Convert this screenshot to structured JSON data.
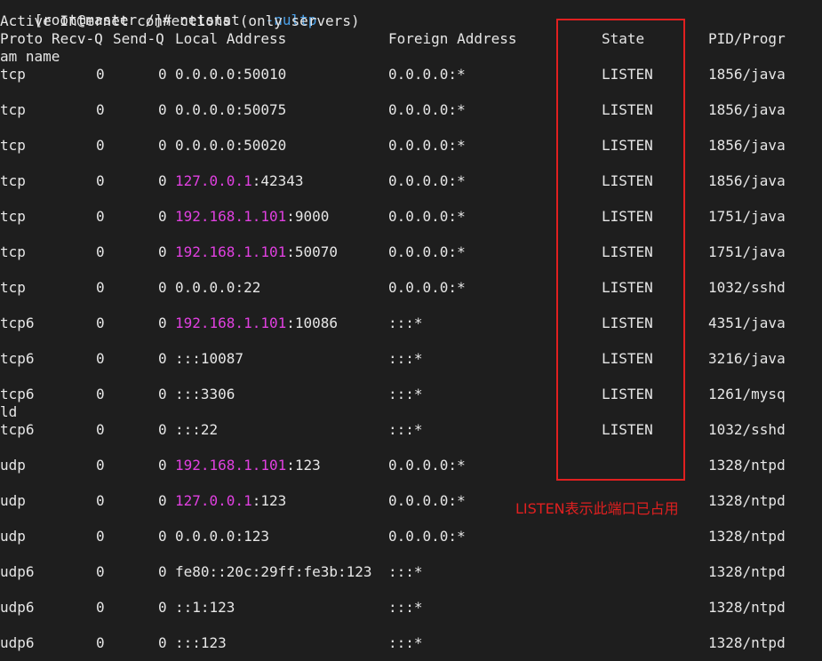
{
  "colors": {
    "background": "#1e1e1e",
    "text": "#e6e6e6",
    "ip_highlight": "#e040e0",
    "command_flag": "#4aa0e8",
    "annotation_red": "#e02020"
  },
  "prompt": {
    "prefix": "[root@master /]# netstat   ",
    "flag": "-nultp"
  },
  "title_line": "Active Internet connections (only servers)",
  "headers": {
    "proto": "Proto",
    "recvq": "Recv-Q",
    "sendq": "Send-Q",
    "local": "Local Address",
    "foreign": "Foreign Address",
    "state": "State",
    "pid": "PID/Progr",
    "pid_wrap": "am name"
  },
  "rows": [
    {
      "proto": "tcp",
      "recvq": "0",
      "sendq": "0",
      "local_ip": "0.0.0.0",
      "local_ip_highlight": false,
      "local_port": ":50010",
      "foreign": "0.0.0.0:*",
      "state": "LISTEN",
      "pid": "1856/java",
      "wrap": ""
    },
    {
      "proto": "tcp",
      "recvq": "0",
      "sendq": "0",
      "local_ip": "0.0.0.0",
      "local_ip_highlight": false,
      "local_port": ":50075",
      "foreign": "0.0.0.0:*",
      "state": "LISTEN",
      "pid": "1856/java",
      "wrap": ""
    },
    {
      "proto": "tcp",
      "recvq": "0",
      "sendq": "0",
      "local_ip": "0.0.0.0",
      "local_ip_highlight": false,
      "local_port": ":50020",
      "foreign": "0.0.0.0:*",
      "state": "LISTEN",
      "pid": "1856/java",
      "wrap": ""
    },
    {
      "proto": "tcp",
      "recvq": "0",
      "sendq": "0",
      "local_ip": "127.0.0.1",
      "local_ip_highlight": true,
      "local_port": ":42343",
      "foreign": "0.0.0.0:*",
      "state": "LISTEN",
      "pid": "1856/java",
      "wrap": ""
    },
    {
      "proto": "tcp",
      "recvq": "0",
      "sendq": "0",
      "local_ip": "192.168.1.101",
      "local_ip_highlight": true,
      "local_port": ":9000",
      "foreign": "0.0.0.0:*",
      "state": "LISTEN",
      "pid": "1751/java",
      "wrap": ""
    },
    {
      "proto": "tcp",
      "recvq": "0",
      "sendq": "0",
      "local_ip": "192.168.1.101",
      "local_ip_highlight": true,
      "local_port": ":50070",
      "foreign": "0.0.0.0:*",
      "state": "LISTEN",
      "pid": "1751/java",
      "wrap": ""
    },
    {
      "proto": "tcp",
      "recvq": "0",
      "sendq": "0",
      "local_ip": "0.0.0.0",
      "local_ip_highlight": false,
      "local_port": ":22",
      "foreign": "0.0.0.0:*",
      "state": "LISTEN",
      "pid": "1032/sshd",
      "wrap": ""
    },
    {
      "proto": "tcp6",
      "recvq": "0",
      "sendq": "0",
      "local_ip": "192.168.1.101",
      "local_ip_highlight": true,
      "local_port": ":10086",
      "foreign": ":::*",
      "state": "LISTEN",
      "pid": "4351/java",
      "wrap": ""
    },
    {
      "proto": "tcp6",
      "recvq": "0",
      "sendq": "0",
      "local_ip": "",
      "local_ip_highlight": false,
      "local_port": ":::10087",
      "foreign": ":::*",
      "state": "LISTEN",
      "pid": "3216/java",
      "wrap": ""
    },
    {
      "proto": "tcp6",
      "recvq": "0",
      "sendq": "0",
      "local_ip": "",
      "local_ip_highlight": false,
      "local_port": ":::3306",
      "foreign": ":::*",
      "state": "LISTEN",
      "pid": "1261/mysq",
      "wrap": "ld"
    },
    {
      "proto": "tcp6",
      "recvq": "0",
      "sendq": "0",
      "local_ip": "",
      "local_ip_highlight": false,
      "local_port": ":::22",
      "foreign": ":::*",
      "state": "LISTEN",
      "pid": "1032/sshd",
      "wrap": ""
    },
    {
      "proto": "udp",
      "recvq": "0",
      "sendq": "0",
      "local_ip": "192.168.1.101",
      "local_ip_highlight": true,
      "local_port": ":123",
      "foreign": "0.0.0.0:*",
      "state": "",
      "pid": "1328/ntpd",
      "wrap": ""
    },
    {
      "proto": "udp",
      "recvq": "0",
      "sendq": "0",
      "local_ip": "127.0.0.1",
      "local_ip_highlight": true,
      "local_port": ":123",
      "foreign": "0.0.0.0:*",
      "state": "",
      "pid": "1328/ntpd",
      "wrap": ""
    },
    {
      "proto": "udp",
      "recvq": "0",
      "sendq": "0",
      "local_ip": "0.0.0.0",
      "local_ip_highlight": false,
      "local_port": ":123",
      "foreign": "0.0.0.0:*",
      "state": "",
      "pid": "1328/ntpd",
      "wrap": ""
    },
    {
      "proto": "udp6",
      "recvq": "0",
      "sendq": "0",
      "local_ip": "",
      "local_ip_highlight": false,
      "local_port": "fe80::20c:29ff:fe3b:123",
      "foreign": ":::*",
      "state": "",
      "pid": "1328/ntpd",
      "wrap": ""
    },
    {
      "proto": "udp6",
      "recvq": "0",
      "sendq": "0",
      "local_ip": "",
      "local_ip_highlight": false,
      "local_port": "::1:123",
      "foreign": ":::*",
      "state": "",
      "pid": "1328/ntpd",
      "wrap": ""
    },
    {
      "proto": "udp6",
      "recvq": "0",
      "sendq": "0",
      "local_ip": "",
      "local_ip_highlight": false,
      "local_port": ":::123",
      "foreign": ":::*",
      "state": "",
      "pid": "1328/ntpd",
      "wrap": ""
    }
  ],
  "annotation": {
    "text": "LISTEN表示此端口已占用"
  }
}
